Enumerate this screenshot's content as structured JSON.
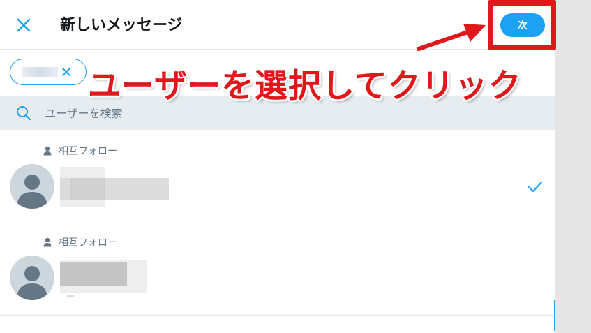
{
  "header": {
    "title": "新しいメッセージ",
    "close_icon": "close-icon",
    "next_label": "次"
  },
  "annotation": {
    "text": "ユーザーを選択してクリック",
    "color": "#e0181b"
  },
  "selected_chips": [
    {
      "remove_icon": "close-icon"
    }
  ],
  "search": {
    "placeholder": "ユーザーを検索",
    "value": ""
  },
  "users": [
    {
      "relation": "相互フォロー",
      "selected": true
    },
    {
      "relation": "相互フォロー",
      "selected": false
    }
  ],
  "colors": {
    "accent": "#1da1f2",
    "highlight": "#e0181b",
    "search_bg": "#e6ecf0",
    "muted_text": "#657786"
  }
}
